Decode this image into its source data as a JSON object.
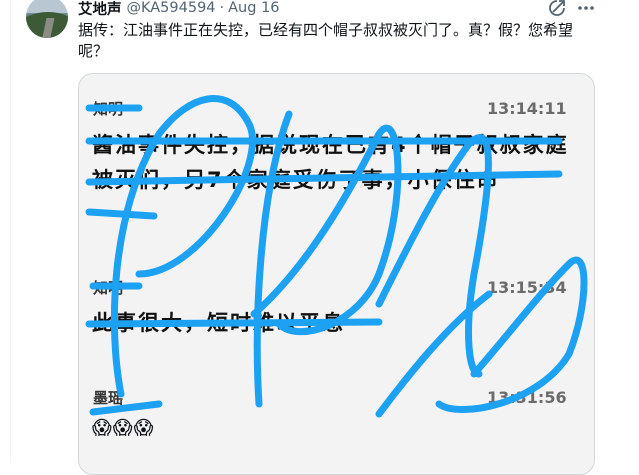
{
  "tweet": {
    "author_name": "艾地声",
    "handle": "@KA594594",
    "separator": "·",
    "date": "Aug 16",
    "text": "据传：江油事件正在失控，已经有四个帽子叔叔被灭门了。真？假？您希望呢？"
  },
  "icons": {
    "avatar": "avatar-photo",
    "header_left": "grok-icon",
    "header_right": "more-icon"
  },
  "screenshot_chat": {
    "messages": [
      {
        "sender": "知明",
        "time": "13:14:11",
        "text": "酱油事件失控，据说现在已有4个帽子叔叔家庭被灭们，另7个家庭受伤了事，小保住命"
      },
      {
        "sender": "知明",
        "time": "13:15:34",
        "text": "此事很大，短时难以平息"
      },
      {
        "sender": "墨瑶",
        "time": "13:31:56",
        "text": "😱😱😱"
      }
    ]
  },
  "colors": {
    "scribble": "#1da1f2",
    "name": "#0f1419",
    "secondary": "#536471",
    "media_bg": "#f3f3f3"
  }
}
